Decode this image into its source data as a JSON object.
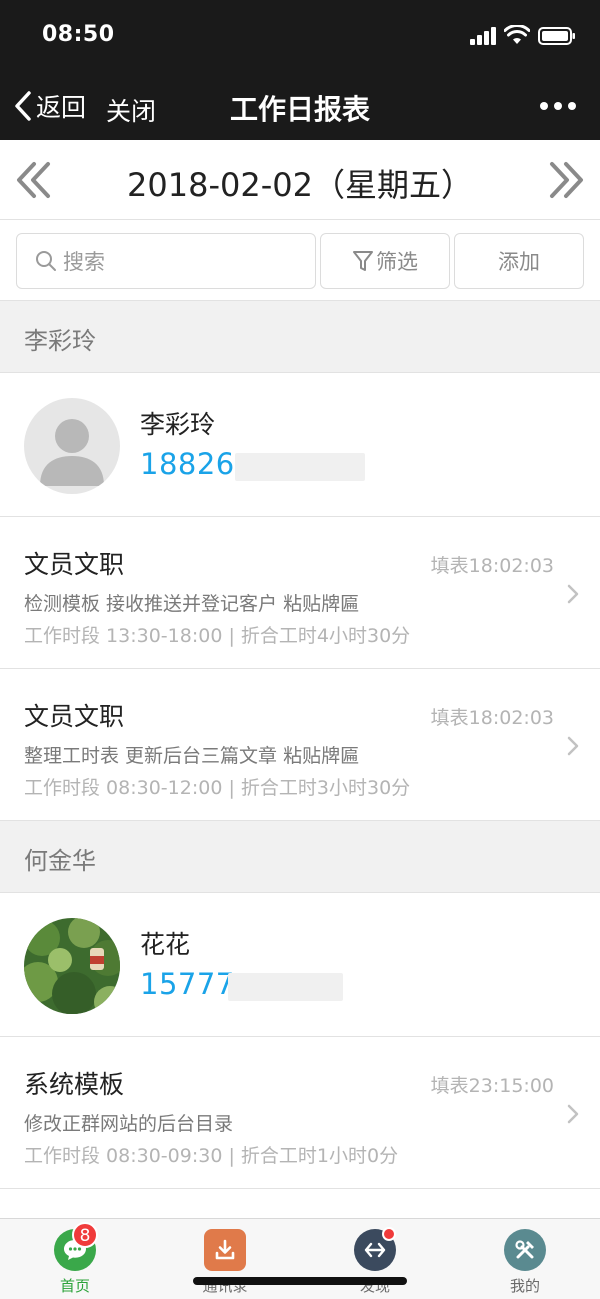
{
  "status": {
    "time": "08:50"
  },
  "nav": {
    "back_label": "返回",
    "close_label": "关闭",
    "title": "工作日报表"
  },
  "date": {
    "label": "2018-02-02（星期五）"
  },
  "toolbar": {
    "search_placeholder": "搜索",
    "filter_label": "筛选",
    "add_label": "添加"
  },
  "groups": [
    {
      "header": "李彩玲",
      "person": {
        "name": "李彩玲",
        "phone": "18826"
      },
      "entries": [
        {
          "title": "文员文职",
          "time": "填表18:02:03",
          "desc": "检测模板 接收推送并登记客户 粘贴牌匾",
          "meta": "工作时段 13:30-18:00 | 折合工时4小时30分"
        },
        {
          "title": "文员文职",
          "time": "填表18:02:03",
          "desc": "整理工时表 更新后台三篇文章 粘贴牌匾",
          "meta": "工作时段 08:30-12:00 | 折合工时3小时30分"
        }
      ]
    },
    {
      "header": "何金华",
      "person": {
        "name": "花花",
        "phone": "15777"
      },
      "entries": [
        {
          "title": "系统模板",
          "time": "填表23:15:00",
          "desc": "修改正群网站的后台目录",
          "meta": "工作时段 08:30-09:30 | 折合工时1小时0分"
        }
      ]
    }
  ],
  "tabbar": {
    "tabs": [
      {
        "label": "首页",
        "icon": "chat-icon",
        "color": "#3aa84a",
        "badge": "8"
      },
      {
        "label": "通讯录",
        "icon": "download-icon",
        "color": "#e07a4a"
      },
      {
        "label": "发现",
        "icon": "exchange-icon",
        "color": "#3b4a5e",
        "dot": true
      },
      {
        "label": "我的",
        "icon": "tools-icon",
        "color": "#5a8a90"
      }
    ]
  },
  "colors": {
    "accent_blue": "#1aa3e8",
    "nav_bg": "#1a1a1a",
    "badge_red": "#f03b3b",
    "active_green": "#2ca33a"
  }
}
